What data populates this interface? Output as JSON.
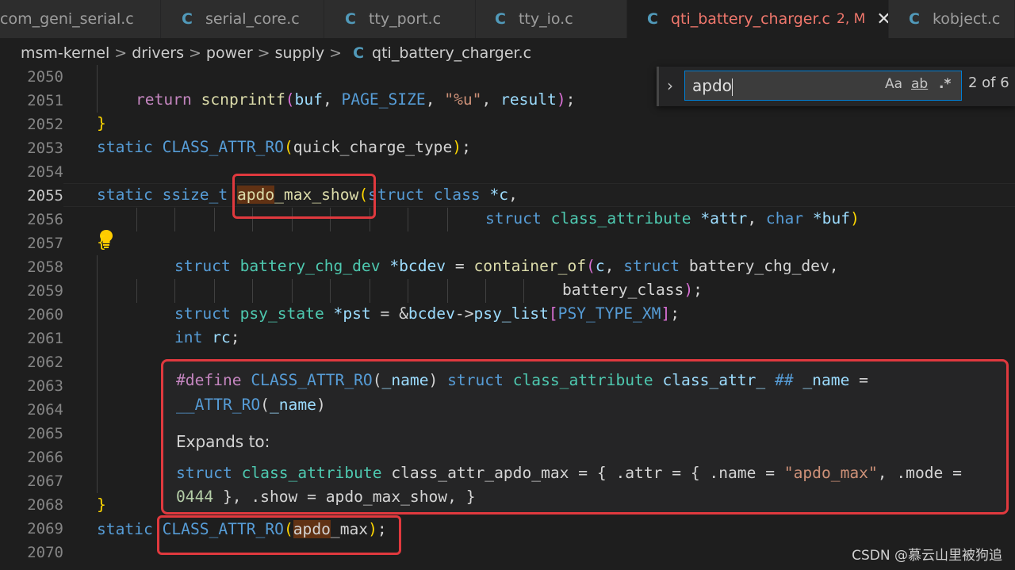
{
  "tabs": [
    {
      "icon": "",
      "label": "com_geni_serial.c",
      "modified": "",
      "active": false
    },
    {
      "icon": "C",
      "label": "serial_core.c",
      "modified": "",
      "active": false
    },
    {
      "icon": "C",
      "label": "tty_port.c",
      "modified": "",
      "active": false
    },
    {
      "icon": "C",
      "label": "tty_io.c",
      "modified": "",
      "active": false
    },
    {
      "icon": "C",
      "label": "qti_battery_charger.c",
      "modified": "2, M",
      "active": true
    },
    {
      "icon": "C",
      "label": "kobject.c",
      "modified": "",
      "active": false
    }
  ],
  "tab_close": "✕",
  "breadcrumb": [
    "msm-kernel",
    "drivers",
    "power",
    "supply",
    "qti_battery_charger.c"
  ],
  "breadcrumb_sep": ">",
  "file_icon": "C",
  "find": {
    "query": "apdo",
    "match_case": "Aa",
    "whole_word": "ab",
    "regex": ".*",
    "result": "2 of 6"
  },
  "line_numbers": [
    "2050",
    "2051",
    "2052",
    "2053",
    "2054",
    "2055",
    "2056",
    "2057",
    "2058",
    "2059",
    "2060",
    "2061",
    "2062",
    "2063",
    "2064",
    "2065",
    "2066",
    "2067",
    "2068",
    "2069",
    "2070"
  ],
  "current_line": "2055",
  "code": {
    "l2051": [
      "return",
      "scnprintf",
      "(",
      "buf",
      ", ",
      "PAGE_SIZE",
      ", ",
      "\"%u\"",
      ", ",
      "result",
      ")",
      ";"
    ],
    "l2052": "}",
    "l2053": [
      "static",
      "CLASS_ATTR_RO",
      "(",
      "quick_charge_type",
      ")",
      ";"
    ],
    "l2055": [
      "static",
      "ssize_t",
      "apdo",
      "_max_show",
      "(",
      "struct",
      "class",
      "*c",
      ","
    ],
    "l2056": [
      "struct",
      "class_attribute",
      "*attr",
      ", ",
      "char",
      "*buf",
      ")"
    ],
    "l2057": "{",
    "l2058": [
      "struct",
      "battery_chg_dev",
      "*bcdev",
      " = ",
      "container_of",
      "(",
      "c",
      ", ",
      "struct",
      "battery_chg_dev",
      ","
    ],
    "l2059": [
      "battery_class",
      ")",
      ";"
    ],
    "l2060": [
      "struct",
      "psy_state",
      "*pst",
      " = &",
      "bcdev",
      "->",
      "psy_list",
      "[",
      "PSY_TYPE_XM",
      "]",
      ";"
    ],
    "l2061": [
      "int",
      "rc",
      ";"
    ],
    "l2068": "}",
    "l2069": [
      "static",
      "CLASS_ATTR_RO",
      "(",
      "apdo",
      "_max",
      ")",
      ";"
    ]
  },
  "hover": {
    "def_line1": [
      "#define",
      "CLASS_ATTR_RO",
      "(",
      "_name",
      ")",
      "struct",
      "class_attribute",
      "class_attr_",
      "##",
      "_name",
      "="
    ],
    "def_line2": [
      "__ATTR_RO",
      "(",
      "_name",
      ")"
    ],
    "expands_label": "Expands to:",
    "exp_line1": [
      "struct",
      "class_attribute",
      "class_attr_apdo_max",
      "= { .",
      "attr",
      " = { .",
      "name",
      " = ",
      "\"apdo_max\"",
      ", .",
      "mode",
      " ="
    ],
    "exp_line2": [
      "0444",
      " }, .",
      "show",
      " = ",
      "apdo_max_show",
      ", }"
    ]
  },
  "watermark": "CSDN @慕云山里被狗追",
  "colors": {
    "accent_red": "#e0393e",
    "find_border": "#007fd4"
  }
}
